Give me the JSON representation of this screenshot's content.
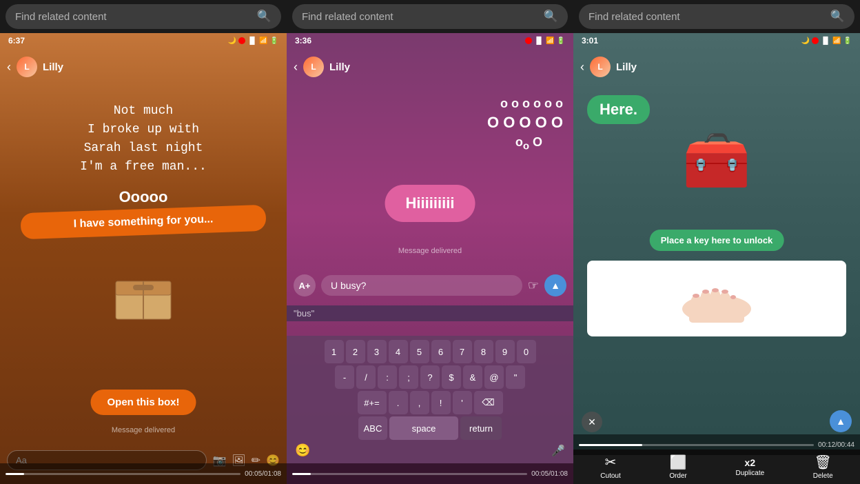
{
  "search": {
    "placeholder": "Find related content"
  },
  "panel1": {
    "time": "6:37",
    "contact": "Lilly",
    "messages": [
      "Not much",
      "I broke up with",
      "Sarah last night",
      "I'm a free man..."
    ],
    "bubble1": "Ooooo",
    "bubble2": "I have something for you...",
    "open_btn": "Open this box!",
    "delivered": "Message delivered",
    "input_placeholder": "Aa",
    "progress_current": "00:05",
    "progress_total": "01:08",
    "progress_pct": 8
  },
  "panel2": {
    "time": "3:36",
    "contact": "Lilly",
    "ooo_text": "o o o o o o",
    "hiii": "Hiiiiiiiii",
    "delivered": "Message delivered",
    "input_value": "U busy?",
    "suggest": "\"bus\"",
    "kb_rows": [
      [
        "1",
        "2",
        "3",
        "4",
        "5",
        "6",
        "7",
        "8",
        "9",
        "0"
      ],
      [
        "-",
        "/",
        ":",
        ";",
        "?",
        "$",
        "&",
        "@",
        "\""
      ],
      [
        "#+=",
        ".",
        ",",
        "!",
        "'",
        "⌫"
      ],
      [
        "ABC",
        "space",
        "return"
      ]
    ],
    "progress_current": "00:05",
    "progress_total": "01:08",
    "progress_pct": 8
  },
  "panel3": {
    "time": "3:01",
    "contact": "Lilly",
    "here_text": "Here.",
    "unlock_text": "Place a key here to unlock",
    "tools": [
      {
        "name": "Cutout",
        "icon": "✂"
      },
      {
        "name": "Order",
        "icon": "🔲"
      },
      {
        "name": "Duplicate",
        "icon": "x2"
      },
      {
        "name": "Delete",
        "icon": "🗑"
      }
    ],
    "progress_current": "00:12",
    "progress_total": "00:44",
    "progress_pct": 27
  }
}
